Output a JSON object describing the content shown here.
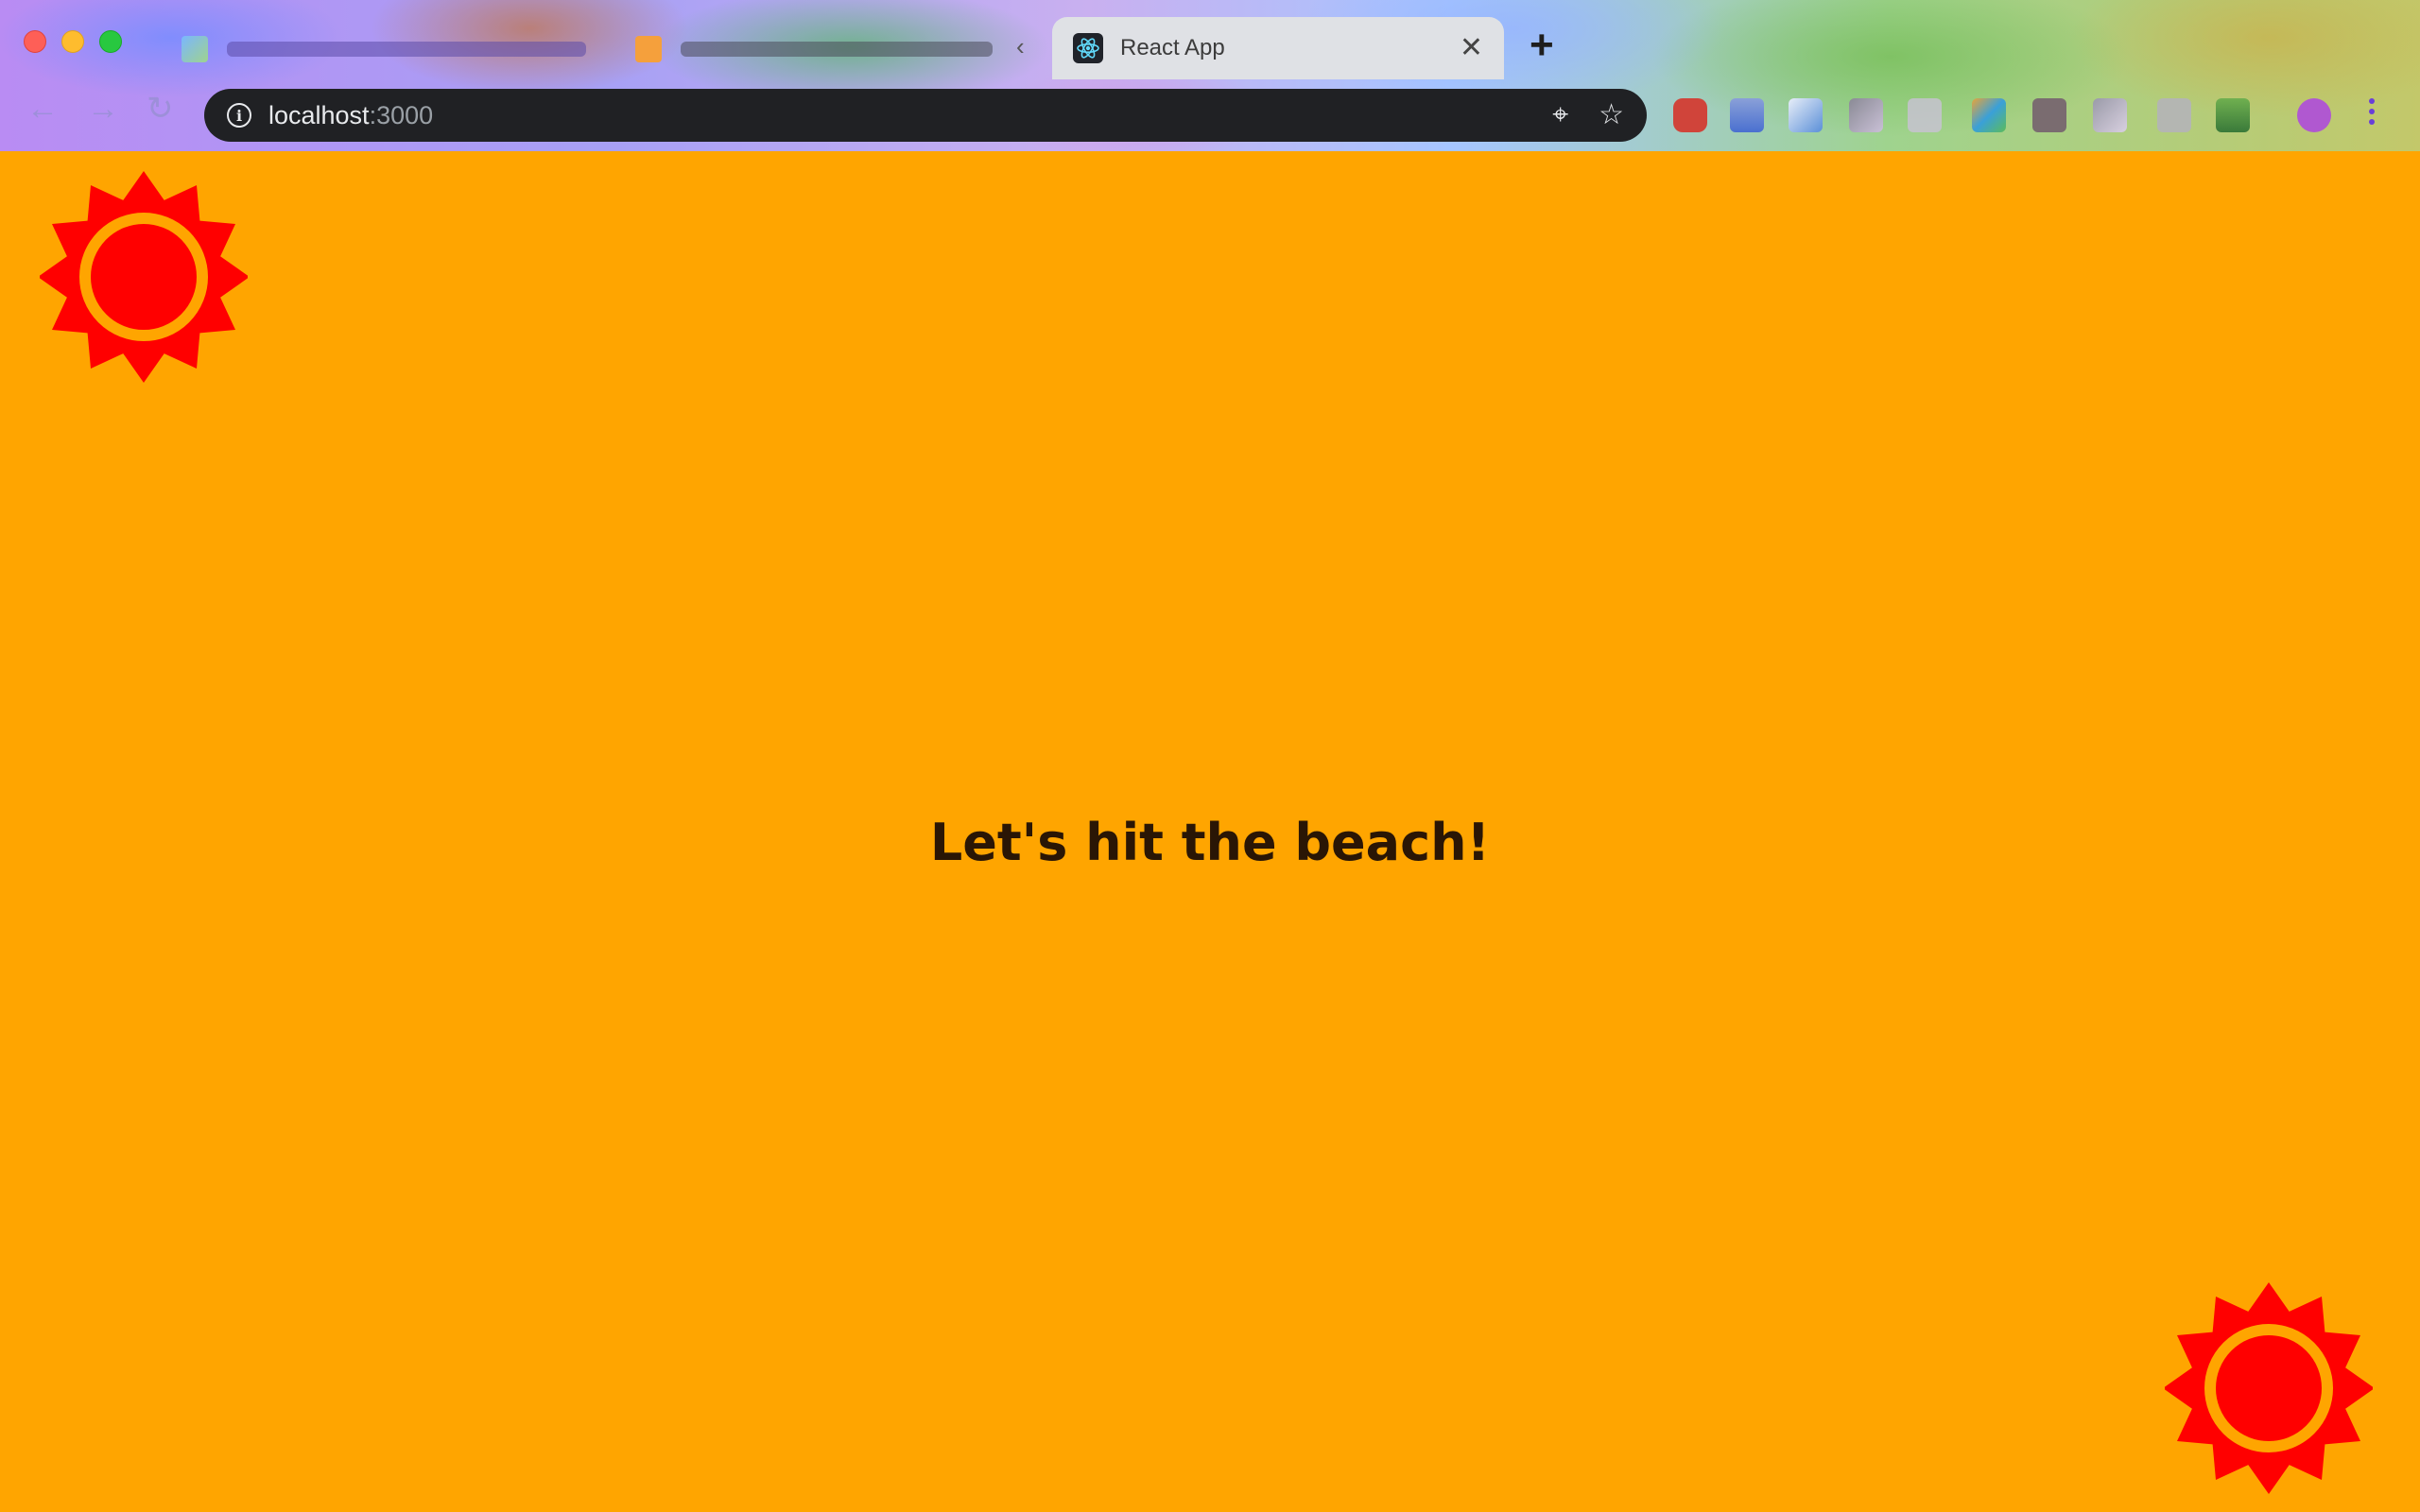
{
  "browser": {
    "active_tab": {
      "title": "React App"
    },
    "new_tab_glyph": "+",
    "close_glyph": "✕",
    "address": {
      "host": "localhost",
      "port": ":3000"
    },
    "nav": {
      "back": "←",
      "forward": "→",
      "reload": "↻"
    },
    "icons": {
      "info": "i",
      "location": "⌖",
      "bookmark": "☆"
    }
  },
  "page": {
    "heading": "Let's hit the beach!",
    "background_color": "#ffa500",
    "sun_color": "#ff0000"
  }
}
